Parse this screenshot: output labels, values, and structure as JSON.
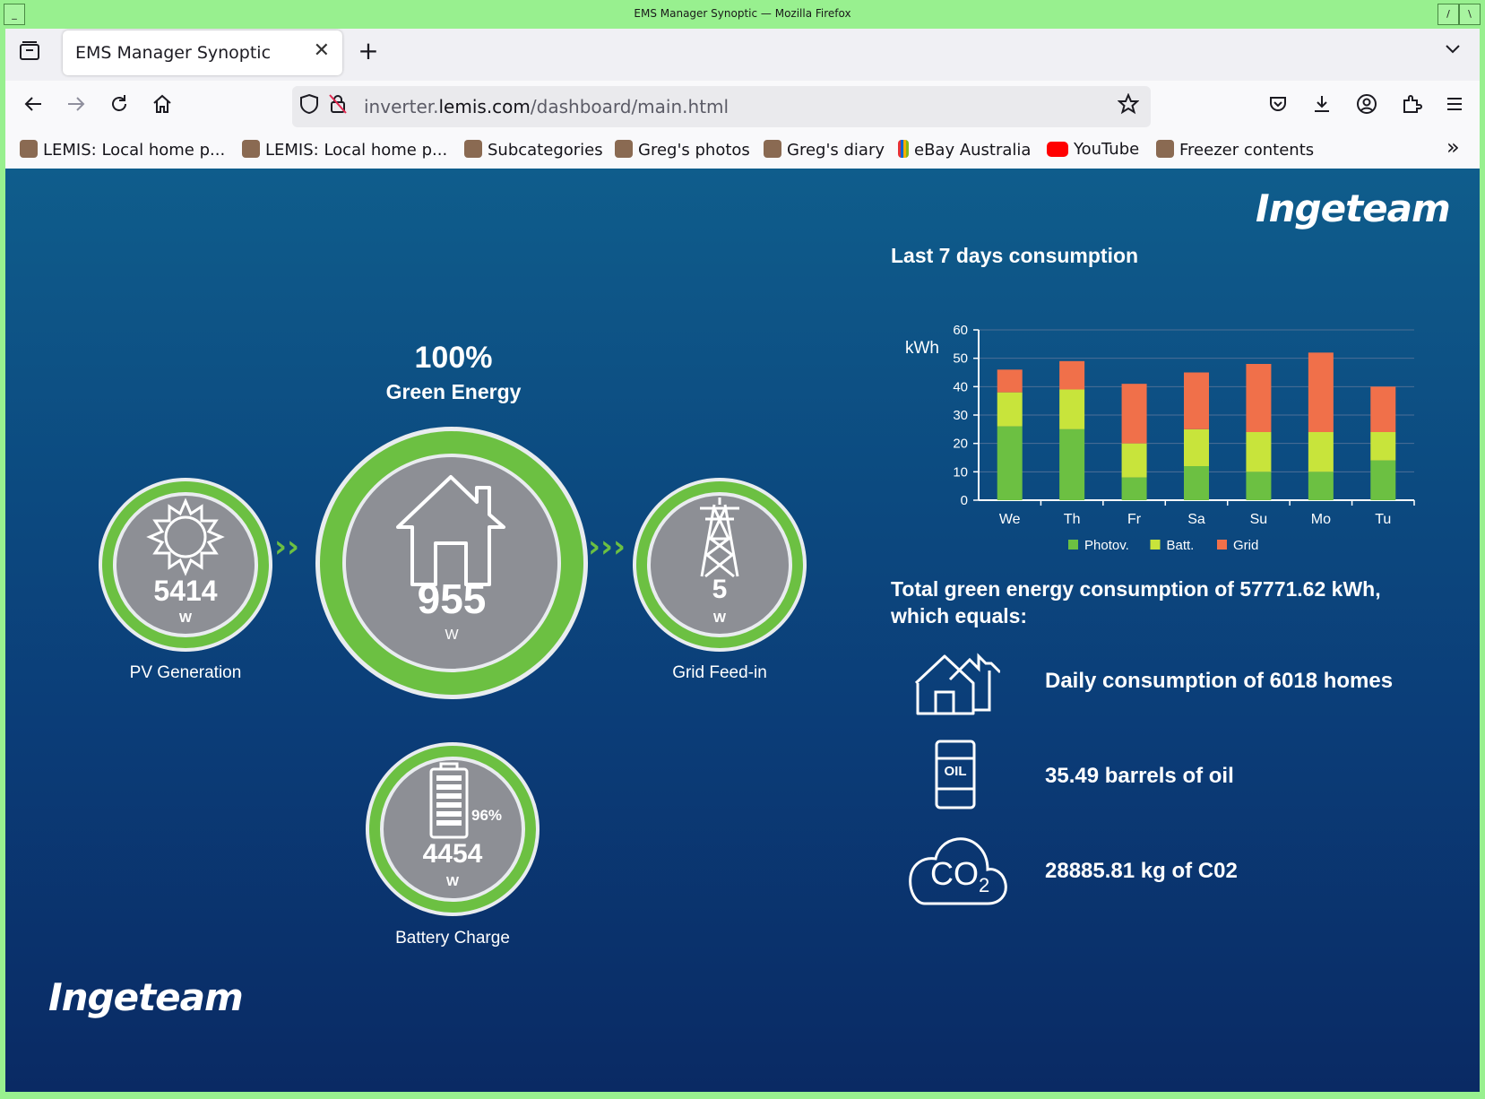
{
  "window": {
    "title": "EMS Manager Synoptic — Mozilla Firefox"
  },
  "browser": {
    "tab_title": "EMS Manager Synoptic",
    "tab_close": "✕",
    "new_tab": "+",
    "url_host_prefix": "inverter.",
    "url_host_main": "lemis.com",
    "url_path": "/dashboard/main.html",
    "bookmarks": [
      {
        "label": "LEMIS: Local home p...",
        "icon": "person-favicon"
      },
      {
        "label": "LEMIS: Local home p...",
        "icon": "person-favicon"
      },
      {
        "label": "Subcategories",
        "icon": "person-favicon"
      },
      {
        "label": "Greg's photos",
        "icon": "person-favicon"
      },
      {
        "label": "Greg's diary",
        "icon": "person-favicon"
      },
      {
        "label": "eBay Australia",
        "icon": "ebay-favicon"
      },
      {
        "label": "YouTube",
        "icon": "youtube-favicon"
      },
      {
        "label": "Freezer contents",
        "icon": "person-favicon"
      }
    ],
    "overflow": "»"
  },
  "page": {
    "brand": "Ingeteam",
    "green_percent": "100%",
    "green_label": "Green Energy",
    "pv": {
      "value": "5414",
      "unit": "W",
      "label": "PV Generation"
    },
    "home": {
      "value": "955",
      "unit": "W"
    },
    "grid": {
      "value": "5",
      "unit": "W",
      "label": "Grid Feed-in"
    },
    "battery": {
      "value": "4454",
      "unit": "W",
      "percent": "96%",
      "label": "Battery Charge"
    },
    "chart_heading": "Last 7 days consumption",
    "total_text": "Total green energy consumption of 57771.62 kWh, which equals:",
    "equivalents": [
      {
        "icon": "homes-icon",
        "text": "Daily consumption of 6018 homes"
      },
      {
        "icon": "oil-barrel-icon",
        "text": "35.49 barrels of oil",
        "icon_label": "OIL"
      },
      {
        "icon": "co2-cloud-icon",
        "text": "28885.81 kg of C02",
        "icon_label": "CO",
        "icon_sub": "2"
      }
    ]
  },
  "colors": {
    "green": "#6cc042",
    "yellow_green": "#c8e43b",
    "orange": "#f0704a",
    "frame_green": "#98f08f"
  },
  "chart_data": {
    "type": "bar",
    "stacked": true,
    "title": "",
    "ylabel": "kWh",
    "xlabel": "",
    "ylim": [
      0,
      60
    ],
    "yticks": [
      0,
      10,
      20,
      30,
      40,
      50,
      60
    ],
    "categories": [
      "We",
      "Th",
      "Fr",
      "Sa",
      "Su",
      "Mo",
      "Tu"
    ],
    "series": [
      {
        "name": "Photov.",
        "color": "#6cc042",
        "values": [
          26,
          25,
          8,
          12,
          10,
          10,
          14
        ]
      },
      {
        "name": "Batt.",
        "color": "#c8e43b",
        "values": [
          12,
          14,
          12,
          13,
          14,
          14,
          10
        ]
      },
      {
        "name": "Grid",
        "color": "#f0704a",
        "values": [
          8,
          10,
          21,
          20,
          24,
          28,
          16
        ]
      }
    ],
    "grid": true,
    "legend": "bottom"
  }
}
